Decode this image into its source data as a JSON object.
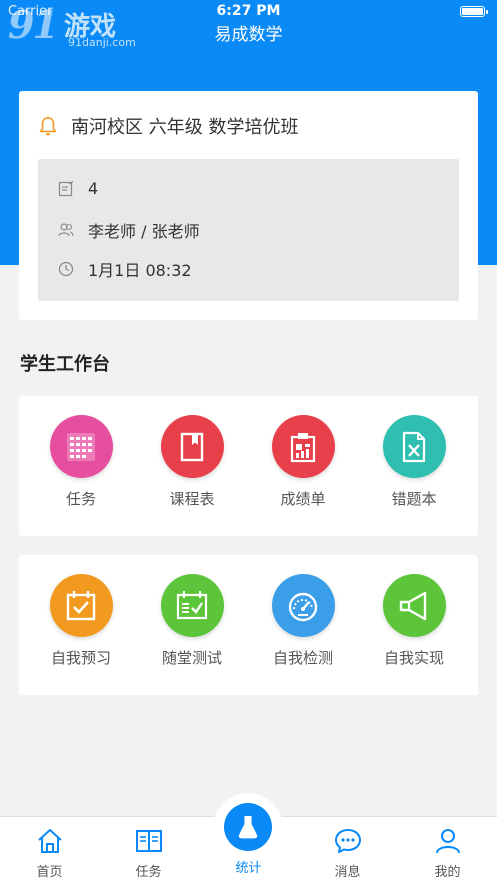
{
  "status_bar": {
    "carrier": "Carrier",
    "time": "6:27 PM"
  },
  "watermark": {
    "logo": "91",
    "name": "游戏",
    "url": "91danji.com"
  },
  "nav": {
    "title": "易成数学"
  },
  "class_card": {
    "name": "南河校区 六年级 数学培优班",
    "lesson_count": "4",
    "teachers": "李老师 / 张老师",
    "time": "1月1日 08:32"
  },
  "workbench": {
    "title": "学生工作台",
    "row1": [
      {
        "label": "任务",
        "icon": "calendar-grid-icon",
        "color": "#e64fa0"
      },
      {
        "label": "课程表",
        "icon": "bookmark-book-icon",
        "color": "#e8404a"
      },
      {
        "label": "成绩单",
        "icon": "clipboard-chart-icon",
        "color": "#e8404a"
      },
      {
        "label": "错题本",
        "icon": "excel-file-icon",
        "color": "#2fbfb0"
      }
    ],
    "row2": [
      {
        "label": "自我预习",
        "icon": "calendar-check-icon",
        "color": "#f29a1f"
      },
      {
        "label": "随堂测试",
        "icon": "calendar-list-check-icon",
        "color": "#5cc53a"
      },
      {
        "label": "自我检测",
        "icon": "speedometer-icon",
        "color": "#3a9ee8"
      },
      {
        "label": "自我实现",
        "icon": "megaphone-icon",
        "color": "#5cc53a"
      }
    ]
  },
  "tabs": [
    {
      "label": "首页",
      "icon": "home-icon"
    },
    {
      "label": "任务",
      "icon": "book-icon"
    },
    {
      "label": "统计",
      "icon": "flask-icon",
      "active": true
    },
    {
      "label": "消息",
      "icon": "chat-icon"
    },
    {
      "label": "我的",
      "icon": "user-icon"
    }
  ],
  "colors": {
    "primary": "#0a8af6",
    "accent_bell": "#f29a1f"
  }
}
